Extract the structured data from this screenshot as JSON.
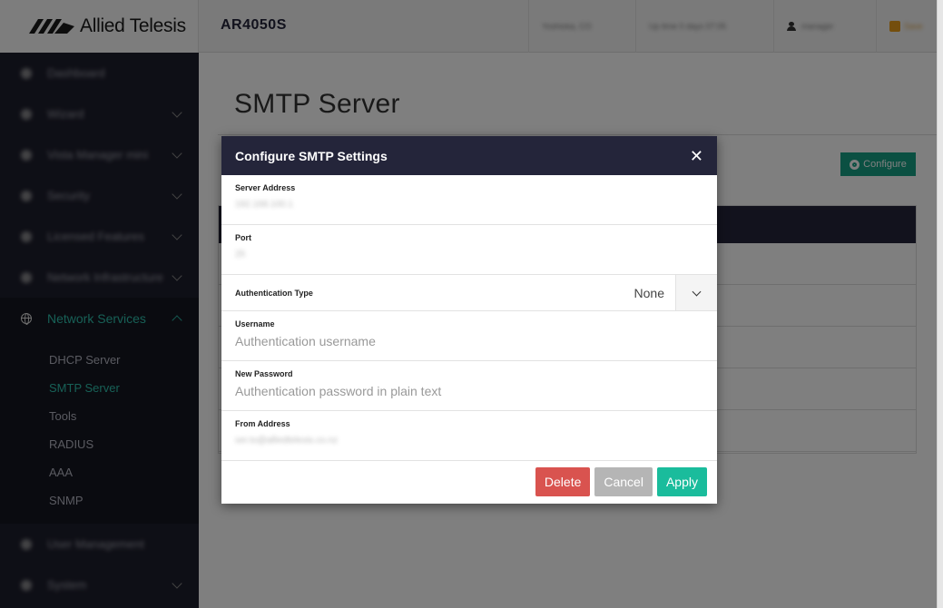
{
  "header": {
    "brand": "Allied Telesis",
    "device": "AR4050S",
    "location_blurred": "Yoshioka, CO",
    "uptime_blurred": "Up time 0 days 07:05",
    "user_blurred": "manager",
    "extra_blurred": "Save"
  },
  "sidebar": {
    "items": [
      {
        "label": "Dashboard",
        "blurred": true
      },
      {
        "label": "Wizard",
        "blurred": true
      },
      {
        "label": "Vista Manager mini",
        "blurred": true
      },
      {
        "label": "Security",
        "blurred": true
      },
      {
        "label": "Licensed Features",
        "blurred": true
      },
      {
        "label": "Network Infrastructure",
        "blurred": true
      }
    ],
    "active_section": "Network Services",
    "sub_items": [
      "DHCP Server",
      "SMTP Server",
      "Tools",
      "RADIUS",
      "AAA",
      "SNMP"
    ],
    "active_sub": "SMTP Server",
    "bottom_items": [
      {
        "label": "User Management",
        "blurred": true
      },
      {
        "label": "System",
        "blurred": true
      }
    ]
  },
  "main": {
    "title": "SMTP Server",
    "configure_label": "Configure"
  },
  "modal": {
    "title": "Configure SMTP Settings",
    "close_glyph": "✕",
    "server_address_label": "Server Address",
    "server_address_blurred": "192.168.100.1",
    "port_label": "Port",
    "port_blurred": "25",
    "auth_type_label": "Authentication Type",
    "auth_type_value": "None",
    "username_label": "Username",
    "username_placeholder": "Authentication username",
    "password_label": "New Password",
    "password_placeholder": "Authentication password in plain text",
    "from_address_label": "From Address",
    "from_address_blurred": "ser.to@alliedtelesis.co.nz",
    "delete_label": "Delete",
    "cancel_label": "Cancel",
    "apply_label": "Apply"
  },
  "colors": {
    "accent": "#2fc1ad",
    "header_dark": "#24253a",
    "delete": "#d9534f",
    "cancel": "#b5b5b5",
    "apply": "#1abc9c"
  }
}
